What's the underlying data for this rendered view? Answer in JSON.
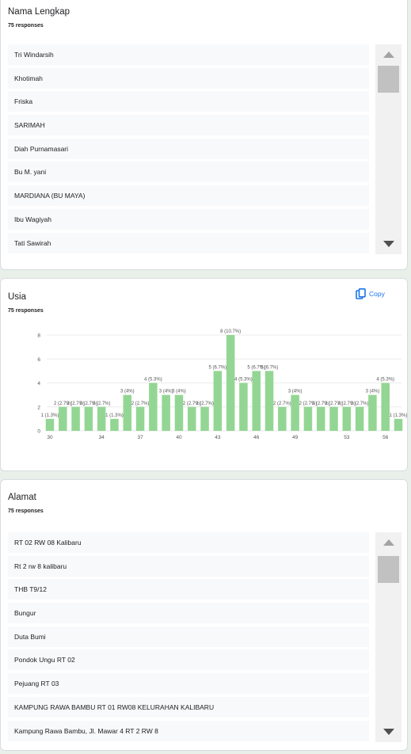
{
  "colors": {
    "bar": "#93d694",
    "accent": "#1a73e8",
    "bg": "#e8f0e9"
  },
  "nama": {
    "title": "Nama Lengkap",
    "responses": "75 responses",
    "items": [
      "Tri Windarsih",
      "Khotimah",
      "Friska",
      "SARIMAH",
      "Diah Purnamasari",
      "Bu M. yani",
      "MARDIANA (BU MAYA)",
      "Ibu Wagiyah",
      "Tati Sawirah"
    ]
  },
  "usia": {
    "title": "Usia",
    "responses": "75 responses",
    "copy_label": "Copy",
    "copy_icon": "copy-icon"
  },
  "alamat": {
    "title": "Alamat",
    "responses": "75 responses",
    "items": [
      "RT 02 RW 08 Kalibaru",
      "Rt 2 rw 8 kalibaru",
      "THB T9/12",
      "Bungur",
      "Duta Bumi",
      "Pondok Ungu RT 02",
      "Pejuang RT 03",
      "KAMPUNG RAWA BAMBU RT 01 RW08 KELURAHAN KALIBARU",
      "Kampung Rawa Bambu, Jl. Mawar 4 RT 2 RW 8"
    ]
  },
  "chart_data": {
    "type": "bar",
    "ylim": [
      0,
      8
    ],
    "yticks": [
      0,
      2,
      4,
      6,
      8
    ],
    "xticks": [
      30,
      34,
      37,
      40,
      43,
      46,
      49,
      53,
      56
    ],
    "x": [
      30,
      31,
      32,
      33,
      34,
      35,
      36,
      37,
      38,
      39,
      40,
      41,
      42,
      43,
      44,
      45,
      46,
      47,
      48,
      49,
      50,
      51,
      52,
      53,
      54,
      55,
      56,
      57
    ],
    "values": [
      1,
      2,
      2,
      2,
      2,
      1,
      3,
      2,
      4,
      3,
      3,
      2,
      2,
      5,
      8,
      4,
      5,
      5,
      2,
      3,
      2,
      2,
      2,
      2,
      2,
      3,
      4,
      1
    ],
    "labels": [
      "1 (1.3%)",
      "2 (2.7%)",
      "2 (2.7%)",
      "2 (2.7%)",
      "2 (2.7%)",
      "1 (1.3%)",
      "3 (4%)",
      "2 (2.7%)",
      "4 (5.3%)",
      "3 (4%)",
      "3 (4%)",
      "2 (2.7%)",
      "2 (2.7%)",
      "5 (6.7%)",
      "8 (10.7%)",
      "4 (5.3%)",
      "5 (6.7%)",
      "5 (6.7%)",
      "2 (2.7%)",
      "3 (4%)",
      "2 (2.7%)",
      "2 (2.7%)",
      "2 (2.7%)",
      "2 (2.7%)",
      "2 (2.7%)",
      "3 (4%)",
      "4 (5.3%)",
      "1 (1.3%)"
    ],
    "grid": true,
    "legend": "none"
  }
}
